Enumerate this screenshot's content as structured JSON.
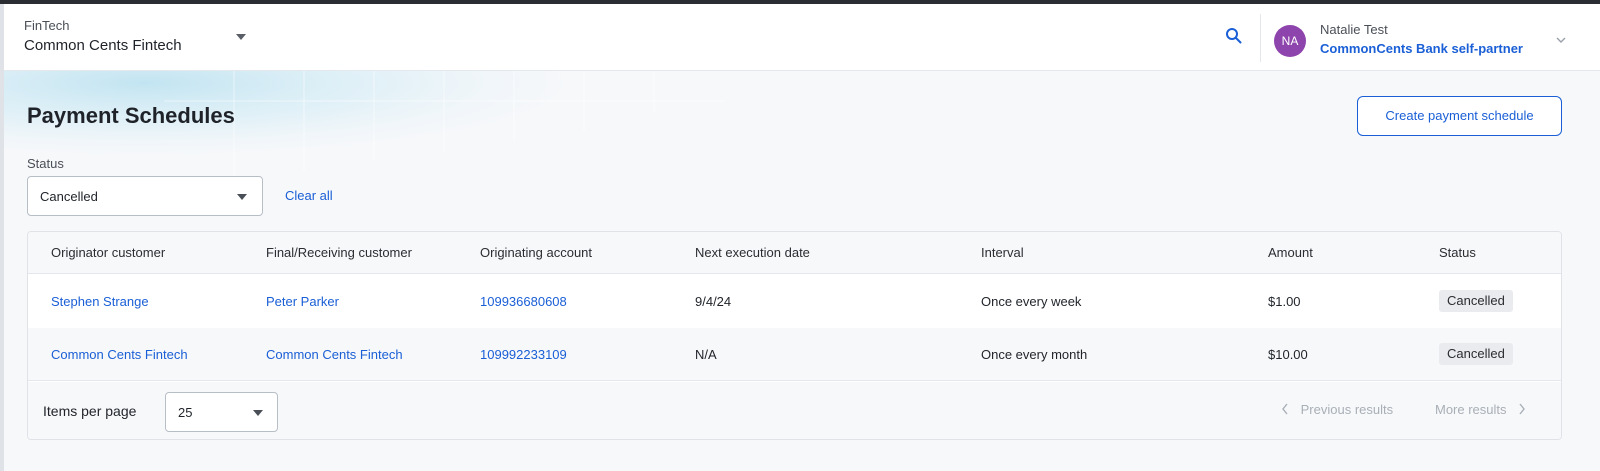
{
  "header": {
    "org_group": "FinTech",
    "org_name": "Common Cents Fintech",
    "user": {
      "initials": "NA",
      "name": "Natalie Test",
      "partner": "CommonCents Bank self-partner",
      "avatar_color": "#8e44ad"
    }
  },
  "page": {
    "title": "Payment Schedules",
    "create_button": "Create payment schedule"
  },
  "filters": {
    "status_label": "Status",
    "status_value": "Cancelled",
    "clear_all": "Clear all"
  },
  "table": {
    "columns": [
      "Originator customer",
      "Final/Receiving customer",
      "Originating account",
      "Next execution date",
      "Interval",
      "Amount",
      "Status"
    ],
    "rows": [
      {
        "originator": "Stephen Strange",
        "receiver": "Peter Parker",
        "account": "109936680608",
        "next_date": "9/4/24",
        "interval": "Once every week",
        "amount": "$1.00",
        "status": "Cancelled"
      },
      {
        "originator": "Common Cents Fintech",
        "receiver": "Common Cents Fintech",
        "account": "109992233109",
        "next_date": "N/A",
        "interval": "Once every month",
        "amount": "$10.00",
        "status": "Cancelled"
      }
    ]
  },
  "pagination": {
    "items_per_page_label": "Items per page",
    "items_per_page_value": "25",
    "previous": "Previous results",
    "next": "More results"
  },
  "colors": {
    "accent": "#1a5fd6",
    "badge_bg": "#e9ebee"
  },
  "icons": {
    "search": "search-icon",
    "caret": "chevron-down-icon",
    "prev": "chevron-left-icon",
    "next": "chevron-right-icon"
  }
}
